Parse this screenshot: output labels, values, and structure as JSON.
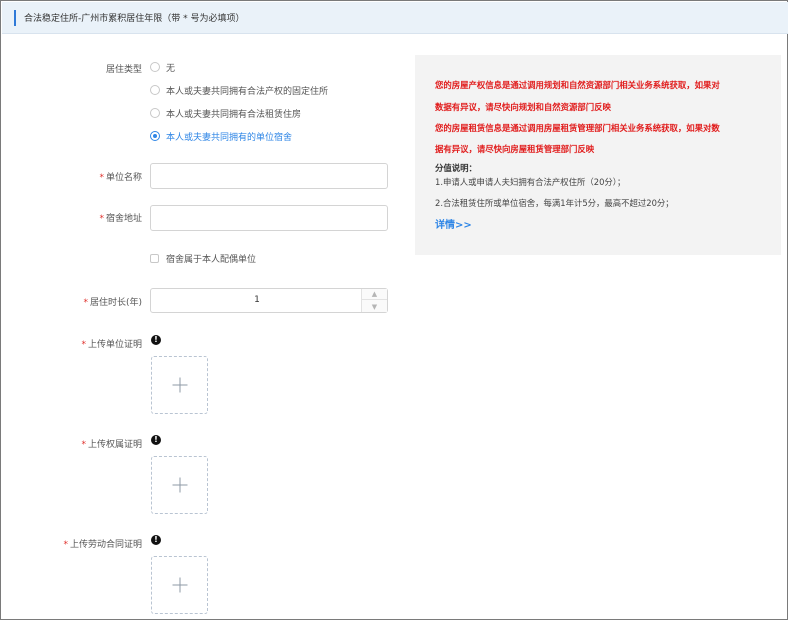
{
  "header": {
    "title": "合法稳定住所-广州市累积居住年限（带 * 号为必填项）"
  },
  "form": {
    "residence_type": {
      "label": "居住类型",
      "options": [
        {
          "label": "无",
          "checked": false
        },
        {
          "label": "本人或夫妻共同拥有合法产权的固定住所",
          "checked": false
        },
        {
          "label": "本人或夫妻共同拥有合法租赁住房",
          "checked": false
        },
        {
          "label": "本人或夫妻共同拥有的单位宿舍",
          "checked": true
        }
      ]
    },
    "required_mark": "*",
    "unit_name": {
      "label": "单位名称",
      "value": "",
      "placeholder": ""
    },
    "dorm_address": {
      "label": "宿舍地址",
      "value": "",
      "placeholder": ""
    },
    "spouse_unit_checkbox": {
      "label": "宿舍属于本人配偶单位",
      "checked": false
    },
    "residence_duration": {
      "label": "居住时长(年)",
      "value": "1"
    },
    "upload_unit_proof": {
      "label": "上传单位证明"
    },
    "upload_ownership_proof": {
      "label": "上传权属证明"
    },
    "upload_labor_contract": {
      "label": "上传劳动合同证明"
    }
  },
  "notice": {
    "line1": "您的房屋产权信息是通过调用规划和自然资源部门相关业务系统获取，如果对",
    "line2": "数据有异议，请尽快向规划和自然资源部门反映",
    "line3": "您的房屋租赁信息是通过调用房屋租赁管理部门相关业务系统获取，如果对数",
    "line4": "据有异议，请尽快向房屋租赁管理部门反映",
    "score_title": "分值说明：",
    "score_1": "1.申请人或申请人夫妇拥有合法产权住所（20分）；",
    "score_2": "2.合法租赁住所或单位宿舍，每满1年计5分，最高不超过20分；",
    "detail_link": "详情>>"
  },
  "icons": {
    "info": "info-icon",
    "upload": "plus-icon",
    "stepper_up": "chevron-up-icon",
    "stepper_down": "chevron-down-icon"
  },
  "colors": {
    "accent": "#2f86e6",
    "required": "#e0302b",
    "notice_red": "#e11d1d",
    "header_bg": "#eaf2f9"
  }
}
